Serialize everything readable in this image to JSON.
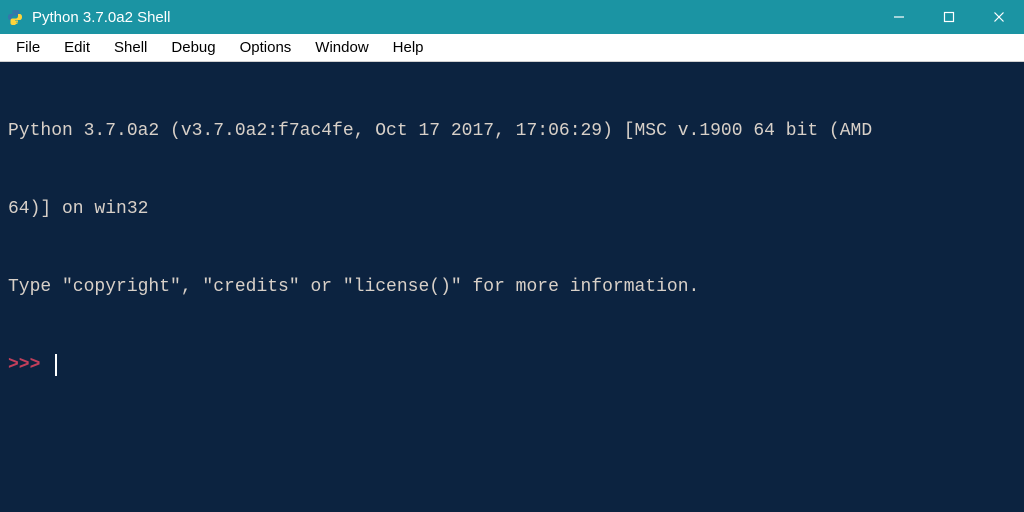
{
  "title": "Python 3.7.0a2 Shell",
  "menubar": {
    "items": [
      "File",
      "Edit",
      "Shell",
      "Debug",
      "Options",
      "Window",
      "Help"
    ]
  },
  "shell": {
    "banner_line1": "Python 3.7.0a2 (v3.7.0a2:f7ac4fe, Oct 17 2017, 17:06:29) [MSC v.1900 64 bit (AMD",
    "banner_line2": "64)] on win32",
    "banner_line3": "Type \"copyright\", \"credits\" or \"license()\" for more information.",
    "prompt": ">>> "
  },
  "colors": {
    "titlebar_bg": "#1b94a3",
    "shell_bg": "#0c2340",
    "text": "#d8d0c8",
    "prompt": "#c33f5b"
  }
}
